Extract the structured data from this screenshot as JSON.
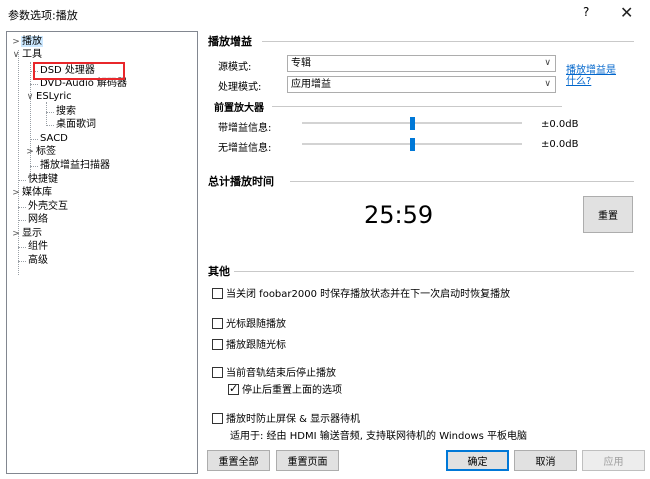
{
  "window": {
    "title": "参数选项:播放",
    "help": "?",
    "close": "✕"
  },
  "tree": {
    "items": [
      {
        "label": "播放",
        "toggle": ">",
        "selected": true
      },
      {
        "label": "工具",
        "toggle": "∨"
      },
      {
        "label": "DSD 处理器"
      },
      {
        "label": "DVD-Audio 解码器"
      },
      {
        "label": "ESLyric",
        "toggle": "∨"
      },
      {
        "label": "搜索"
      },
      {
        "label": "桌面歌词"
      },
      {
        "label": "SACD"
      },
      {
        "label": "标签",
        "toggle": ">"
      },
      {
        "label": "播放增益扫描器"
      },
      {
        "label": "快捷键"
      },
      {
        "label": "媒体库",
        "toggle": ">"
      },
      {
        "label": "外壳交互"
      },
      {
        "label": "网络"
      },
      {
        "label": "显示",
        "toggle": ">"
      },
      {
        "label": "组件"
      },
      {
        "label": "高级"
      }
    ]
  },
  "gain": {
    "title": "播放增益",
    "source_label": "源模式:",
    "source_value": "专辑",
    "process_label": "处理模式:",
    "process_value": "应用增益",
    "link": "播放增益是什么?"
  },
  "preamp": {
    "title": "前置放大器",
    "with_label": "带增益信息:",
    "with_value": "±0.0dB",
    "with_level": 0.5,
    "without_label": "无增益信息:",
    "without_value": "±0.0dB",
    "without_level": 0.5
  },
  "total": {
    "title": "总计播放时间",
    "time": "25:59",
    "reset": "重置"
  },
  "other": {
    "title": "其他",
    "opt1": "当关闭 foobar2000 时保存播放状态并在下一次启动时恢复播放",
    "opt2": "光标跟随播放",
    "opt3": "播放跟随光标",
    "opt4": "当前音轨结束后停止播放",
    "opt4a": "停止后重置上面的选项",
    "opt5": "播放时防止屏保 & 显示器待机",
    "opt5_note": "适用于: 经由 HDMI 输送音频, 支持联网待机的 Windows 平板电脑"
  },
  "buttons": {
    "reset_all": "重置全部",
    "reset_page": "重置页面",
    "ok": "确定",
    "cancel": "取消",
    "apply": "应用"
  }
}
